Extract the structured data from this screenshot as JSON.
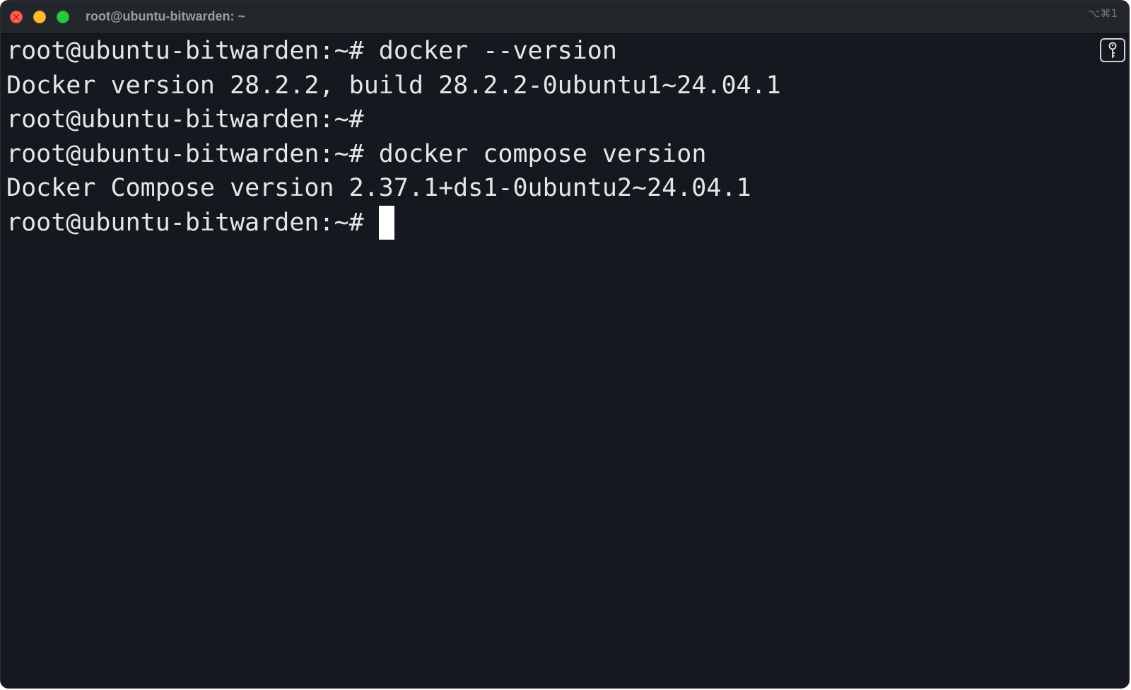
{
  "window": {
    "title": "root@ubuntu-bitwarden: ~",
    "shortcut": "⌥⌘1",
    "traffic_lights": {
      "close": "#ff5f57",
      "minimize": "#febc2e",
      "maximize": "#28c840"
    },
    "background": "#15191f"
  },
  "terminal": {
    "prompt": "root@ubuntu-bitwarden:~#",
    "lines": [
      {
        "prompt": "root@ubuntu-bitwarden:~#",
        "text": " docker --version"
      },
      {
        "prompt": "",
        "text": "Docker version 28.2.2, build 28.2.2-0ubuntu1~24.04.1"
      },
      {
        "prompt": "root@ubuntu-bitwarden:~#",
        "text": ""
      },
      {
        "prompt": "root@ubuntu-bitwarden:~#",
        "text": " docker compose version"
      },
      {
        "prompt": "",
        "text": "Docker Compose version 2.37.1+ds1-0ubuntu2~24.04.1"
      },
      {
        "prompt": "root@ubuntu-bitwarden:~#",
        "text": " "
      }
    ],
    "text_color": "#e6e6e6"
  },
  "icons": {
    "close": "close-button",
    "minimize": "minimize-button",
    "maximize": "maximize-button",
    "secure_input": "key-icon"
  }
}
